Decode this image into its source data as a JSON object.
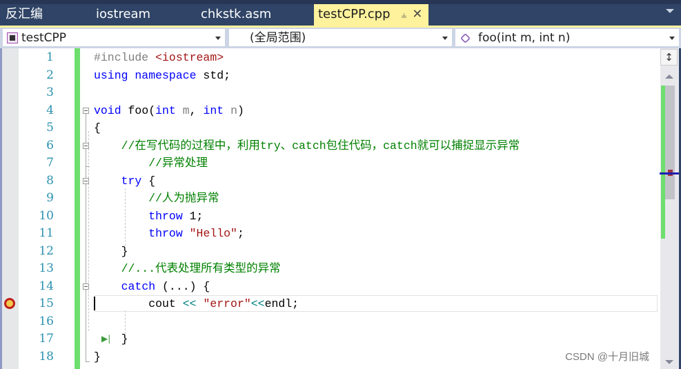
{
  "tabs": [
    {
      "label": "反汇编",
      "active": false
    },
    {
      "label": "iostream",
      "active": false
    },
    {
      "label": "chkstk.asm",
      "active": false
    },
    {
      "label": "testCPP.cpp",
      "active": true,
      "pin_icon": "pin-icon",
      "close_icon": "close-icon"
    }
  ],
  "navbar": {
    "project": "testCPP",
    "scope": "(全局范围)",
    "member": "foo(int m, int n)"
  },
  "editor": {
    "lines": [
      {
        "n": "1"
      },
      {
        "n": "2"
      },
      {
        "n": "3"
      },
      {
        "n": "4"
      },
      {
        "n": "5"
      },
      {
        "n": "6"
      },
      {
        "n": "7"
      },
      {
        "n": "8"
      },
      {
        "n": "9"
      },
      {
        "n": "10"
      },
      {
        "n": "11"
      },
      {
        "n": "12"
      },
      {
        "n": "13"
      },
      {
        "n": "14"
      },
      {
        "n": "15"
      },
      {
        "n": "16"
      },
      {
        "n": "17"
      },
      {
        "n": "18"
      }
    ],
    "code": {
      "l1_pp": "#include ",
      "l1_inc": "<iostream>",
      "l2_kw": "using namespace",
      "l2_rest": " std;",
      "l4_void": "void",
      "l4_a": " foo(",
      "l4_int1": "int",
      "l4_m": " m",
      "l4_b": ", ",
      "l4_int2": "int",
      "l4_n": " n",
      "l4_c": ")",
      "l5": "{",
      "l6": "    //在写代码的过程中，利用try、catch包住代码，catch就可以捕捉显示异常",
      "l7": "        //异常处理",
      "l8_indent": "    ",
      "l8_kw": "try",
      "l8_rest": " {",
      "l9": "        //人为抛异常",
      "l10_indent": "        ",
      "l10_kw": "throw",
      "l10_rest": " 1;",
      "l11_indent": "        ",
      "l11_kw": "throw",
      "l11_sp": " ",
      "l11_str": "\"Hello\"",
      "l11_end": ";",
      "l12": "    }",
      "l13": "    //...代表处理所有类型的异常",
      "l14_indent": "    ",
      "l14_kw": "catch",
      "l14_rest": " (...) {",
      "l15_a": "        cout ",
      "l15_op1": "<<",
      "l15_sp": " ",
      "l15_str": "\"error\"",
      "l15_op2": "<<",
      "l15_end": "endl;",
      "l17": "    }",
      "l18": "}"
    },
    "current_line": "15"
  },
  "scrollbar": {
    "splitter_icon": "split-icon"
  },
  "watermark": "CSDN @十月旧城"
}
